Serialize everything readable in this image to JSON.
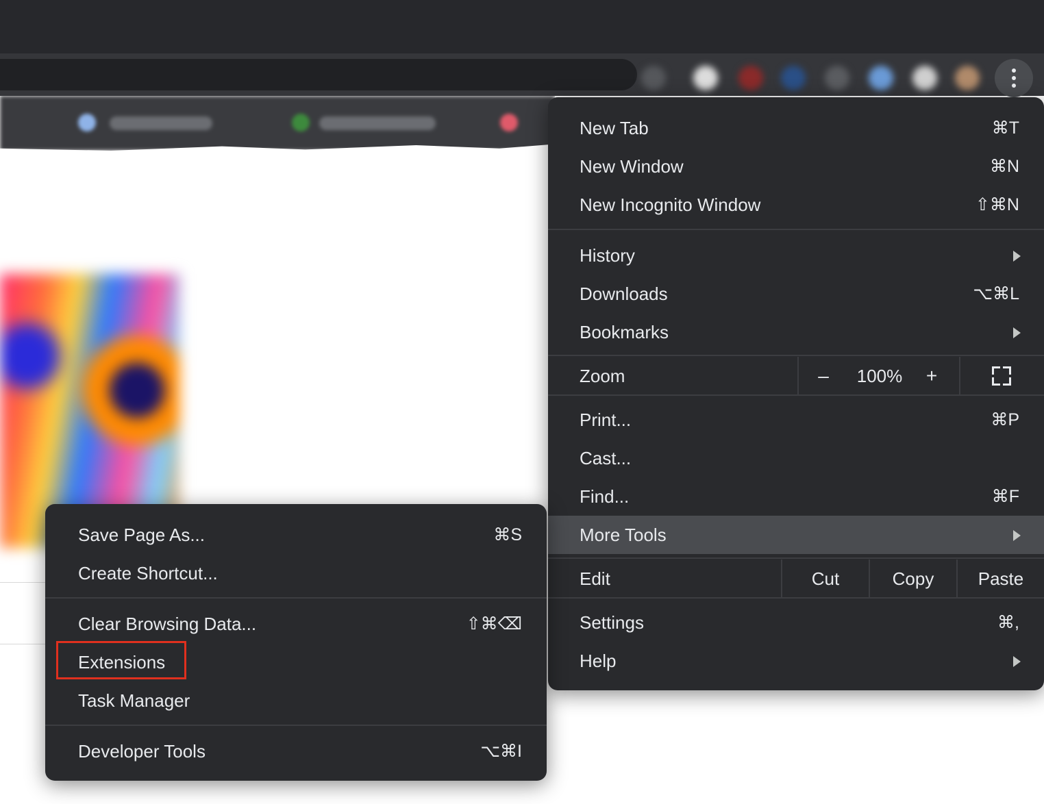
{
  "main_menu": {
    "group1": [
      {
        "label": "New Tab",
        "shortcut": "⌘T"
      },
      {
        "label": "New Window",
        "shortcut": "⌘N"
      },
      {
        "label": "New Incognito Window",
        "shortcut": "⇧⌘N"
      }
    ],
    "group2": [
      {
        "label": "History",
        "shortcut": "",
        "submenu": true
      },
      {
        "label": "Downloads",
        "shortcut": "⌥⌘L"
      },
      {
        "label": "Bookmarks",
        "shortcut": "",
        "submenu": true
      }
    ],
    "zoom": {
      "label": "Zoom",
      "minus": "–",
      "value": "100%",
      "plus": "+",
      "fullscreen_icon": "fullscreen-icon"
    },
    "group3": [
      {
        "label": "Print...",
        "shortcut": "⌘P"
      },
      {
        "label": "Cast...",
        "shortcut": ""
      },
      {
        "label": "Find...",
        "shortcut": "⌘F"
      },
      {
        "label": "More Tools",
        "shortcut": "",
        "submenu": true,
        "active": true
      }
    ],
    "edit": {
      "label": "Edit",
      "cut": "Cut",
      "copy": "Copy",
      "paste": "Paste"
    },
    "group4": [
      {
        "label": "Settings",
        "shortcut": "⌘,"
      },
      {
        "label": "Help",
        "shortcut": "",
        "submenu": true
      }
    ]
  },
  "more_tools_menu": {
    "group1": [
      {
        "label": "Save Page As...",
        "shortcut": "⌘S"
      },
      {
        "label": "Create Shortcut...",
        "shortcut": ""
      }
    ],
    "group2": [
      {
        "label": "Clear Browsing Data...",
        "shortcut": "⇧⌘⌫"
      },
      {
        "label": "Extensions",
        "shortcut": "",
        "highlighted": true
      },
      {
        "label": "Task Manager",
        "shortcut": ""
      }
    ],
    "group3": [
      {
        "label": "Developer Tools",
        "shortcut": "⌥⌘I"
      }
    ]
  },
  "colors": {
    "menu_bg": "#292a2d",
    "active_item_bg": "#4a4c50",
    "highlight_border": "#e0301e",
    "text": "#e8eaed"
  },
  "icons": {
    "kebab": "three-dot-menu-icon",
    "submenu_arrow": "triangle-right-icon"
  }
}
